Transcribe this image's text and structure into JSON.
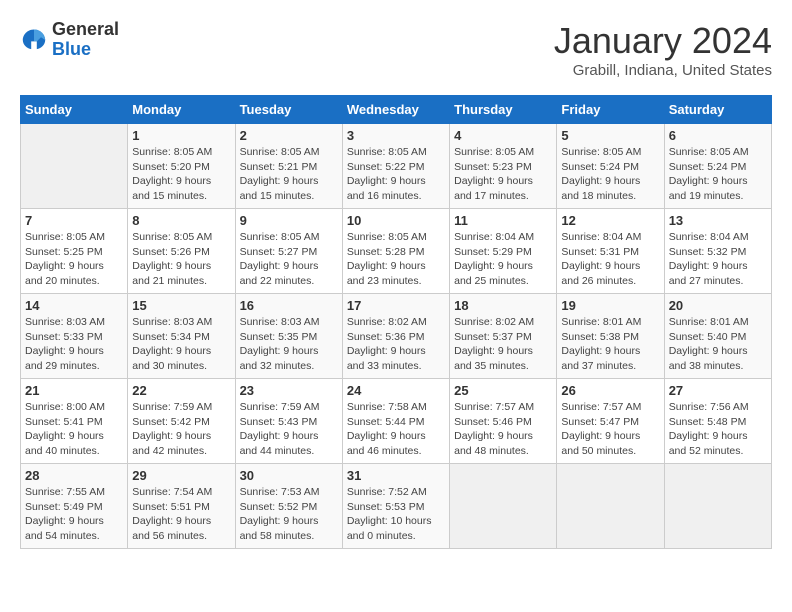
{
  "logo": {
    "general": "General",
    "blue": "Blue"
  },
  "header": {
    "title": "January 2024",
    "subtitle": "Grabill, Indiana, United States"
  },
  "weekdays": [
    "Sunday",
    "Monday",
    "Tuesday",
    "Wednesday",
    "Thursday",
    "Friday",
    "Saturday"
  ],
  "weeks": [
    [
      {
        "day": "",
        "empty": true
      },
      {
        "day": "1",
        "sunrise": "8:05 AM",
        "sunset": "5:20 PM",
        "daylight": "9 hours and 15 minutes."
      },
      {
        "day": "2",
        "sunrise": "8:05 AM",
        "sunset": "5:21 PM",
        "daylight": "9 hours and 15 minutes."
      },
      {
        "day": "3",
        "sunrise": "8:05 AM",
        "sunset": "5:22 PM",
        "daylight": "9 hours and 16 minutes."
      },
      {
        "day": "4",
        "sunrise": "8:05 AM",
        "sunset": "5:23 PM",
        "daylight": "9 hours and 17 minutes."
      },
      {
        "day": "5",
        "sunrise": "8:05 AM",
        "sunset": "5:24 PM",
        "daylight": "9 hours and 18 minutes."
      },
      {
        "day": "6",
        "sunrise": "8:05 AM",
        "sunset": "5:24 PM",
        "daylight": "9 hours and 19 minutes."
      }
    ],
    [
      {
        "day": "7",
        "sunrise": "8:05 AM",
        "sunset": "5:25 PM",
        "daylight": "9 hours and 20 minutes."
      },
      {
        "day": "8",
        "sunrise": "8:05 AM",
        "sunset": "5:26 PM",
        "daylight": "9 hours and 21 minutes."
      },
      {
        "day": "9",
        "sunrise": "8:05 AM",
        "sunset": "5:27 PM",
        "daylight": "9 hours and 22 minutes."
      },
      {
        "day": "10",
        "sunrise": "8:05 AM",
        "sunset": "5:28 PM",
        "daylight": "9 hours and 23 minutes."
      },
      {
        "day": "11",
        "sunrise": "8:04 AM",
        "sunset": "5:29 PM",
        "daylight": "9 hours and 25 minutes."
      },
      {
        "day": "12",
        "sunrise": "8:04 AM",
        "sunset": "5:31 PM",
        "daylight": "9 hours and 26 minutes."
      },
      {
        "day": "13",
        "sunrise": "8:04 AM",
        "sunset": "5:32 PM",
        "daylight": "9 hours and 27 minutes."
      }
    ],
    [
      {
        "day": "14",
        "sunrise": "8:03 AM",
        "sunset": "5:33 PM",
        "daylight": "9 hours and 29 minutes."
      },
      {
        "day": "15",
        "sunrise": "8:03 AM",
        "sunset": "5:34 PM",
        "daylight": "9 hours and 30 minutes."
      },
      {
        "day": "16",
        "sunrise": "8:03 AM",
        "sunset": "5:35 PM",
        "daylight": "9 hours and 32 minutes."
      },
      {
        "day": "17",
        "sunrise": "8:02 AM",
        "sunset": "5:36 PM",
        "daylight": "9 hours and 33 minutes."
      },
      {
        "day": "18",
        "sunrise": "8:02 AM",
        "sunset": "5:37 PM",
        "daylight": "9 hours and 35 minutes."
      },
      {
        "day": "19",
        "sunrise": "8:01 AM",
        "sunset": "5:38 PM",
        "daylight": "9 hours and 37 minutes."
      },
      {
        "day": "20",
        "sunrise": "8:01 AM",
        "sunset": "5:40 PM",
        "daylight": "9 hours and 38 minutes."
      }
    ],
    [
      {
        "day": "21",
        "sunrise": "8:00 AM",
        "sunset": "5:41 PM",
        "daylight": "9 hours and 40 minutes."
      },
      {
        "day": "22",
        "sunrise": "7:59 AM",
        "sunset": "5:42 PM",
        "daylight": "9 hours and 42 minutes."
      },
      {
        "day": "23",
        "sunrise": "7:59 AM",
        "sunset": "5:43 PM",
        "daylight": "9 hours and 44 minutes."
      },
      {
        "day": "24",
        "sunrise": "7:58 AM",
        "sunset": "5:44 PM",
        "daylight": "9 hours and 46 minutes."
      },
      {
        "day": "25",
        "sunrise": "7:57 AM",
        "sunset": "5:46 PM",
        "daylight": "9 hours and 48 minutes."
      },
      {
        "day": "26",
        "sunrise": "7:57 AM",
        "sunset": "5:47 PM",
        "daylight": "9 hours and 50 minutes."
      },
      {
        "day": "27",
        "sunrise": "7:56 AM",
        "sunset": "5:48 PM",
        "daylight": "9 hours and 52 minutes."
      }
    ],
    [
      {
        "day": "28",
        "sunrise": "7:55 AM",
        "sunset": "5:49 PM",
        "daylight": "9 hours and 54 minutes."
      },
      {
        "day": "29",
        "sunrise": "7:54 AM",
        "sunset": "5:51 PM",
        "daylight": "9 hours and 56 minutes."
      },
      {
        "day": "30",
        "sunrise": "7:53 AM",
        "sunset": "5:52 PM",
        "daylight": "9 hours and 58 minutes."
      },
      {
        "day": "31",
        "sunrise": "7:52 AM",
        "sunset": "5:53 PM",
        "daylight": "10 hours and 0 minutes."
      },
      {
        "day": "",
        "empty": true
      },
      {
        "day": "",
        "empty": true
      },
      {
        "day": "",
        "empty": true
      }
    ]
  ]
}
